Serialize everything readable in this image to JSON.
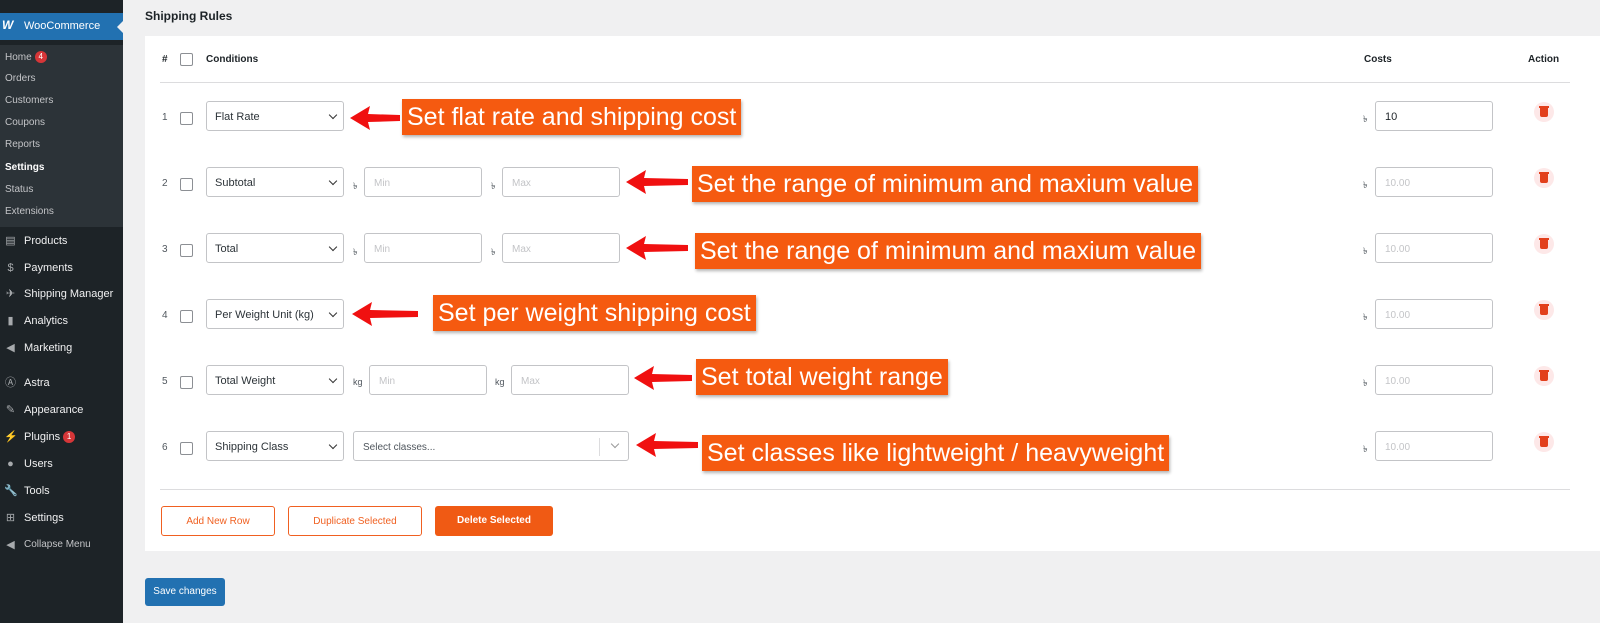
{
  "sidebar": {
    "woocommerce": "WooCommerce",
    "submenu": [
      {
        "label": "Home",
        "badge": "4"
      },
      {
        "label": "Orders"
      },
      {
        "label": "Customers"
      },
      {
        "label": "Coupons"
      },
      {
        "label": "Reports"
      },
      {
        "label": "Settings"
      },
      {
        "label": "Status"
      },
      {
        "label": "Extensions"
      }
    ],
    "menu": [
      {
        "label": "Products",
        "icon": "products-icon"
      },
      {
        "label": "Payments",
        "icon": "payments-icon"
      },
      {
        "label": "Shipping Manager",
        "icon": "shipping-icon"
      },
      {
        "label": "Analytics",
        "icon": "analytics-icon"
      },
      {
        "label": "Marketing",
        "icon": "marketing-icon"
      },
      {
        "label": "Astra",
        "icon": "astra-icon"
      },
      {
        "label": "Appearance",
        "icon": "appearance-icon"
      },
      {
        "label": "Plugins",
        "icon": "plugins-icon",
        "badge": "1"
      },
      {
        "label": "Users",
        "icon": "users-icon"
      },
      {
        "label": "Tools",
        "icon": "tools-icon"
      },
      {
        "label": "Settings",
        "icon": "settings-icon"
      },
      {
        "label": "Collapse Menu",
        "icon": "collapse-icon"
      }
    ]
  },
  "section_title": "Shipping Rules",
  "table": {
    "headers": {
      "num": "#",
      "conditions": "Conditions",
      "costs": "Costs",
      "action": "Action"
    },
    "rows": [
      {
        "num": "1",
        "condition": "Flat Rate",
        "cost": "10",
        "cost_placeholder": ""
      },
      {
        "num": "2",
        "condition": "Subtotal",
        "min_unit": "৳",
        "min_placeholder": "Min",
        "max_unit": "৳",
        "max_placeholder": "Max",
        "cost_placeholder": "10.00"
      },
      {
        "num": "3",
        "condition": "Total",
        "min_unit": "৳",
        "min_placeholder": "Min",
        "max_unit": "৳",
        "max_placeholder": "Max",
        "cost_placeholder": "10.00"
      },
      {
        "num": "4",
        "condition": "Per Weight Unit (kg)",
        "cost_placeholder": "10.00"
      },
      {
        "num": "5",
        "condition": "Total Weight",
        "min_unit": "kg",
        "min_placeholder": "Min",
        "max_unit": "kg",
        "max_placeholder": "Max",
        "cost_placeholder": "10.00"
      },
      {
        "num": "6",
        "condition": "Shipping Class",
        "classes_placeholder": "Select classes...",
        "cost_placeholder": "10.00"
      }
    ],
    "currency": "৳"
  },
  "buttons": {
    "add_row": "Add New Row",
    "duplicate": "Duplicate Selected",
    "delete": "Delete Selected",
    "save": "Save changes"
  },
  "annotations": [
    "Set flat rate and shipping cost",
    "Set the range of minimum and maxium value",
    "Set the range of minimum and maxium value",
    "Set per weight shipping cost",
    "Set total weight range",
    "Set classes like lightweight / heavyweight"
  ],
  "colors": {
    "accent": "#f05a14",
    "wp_blue": "#2271b1",
    "sidebar": "#1d2327"
  }
}
